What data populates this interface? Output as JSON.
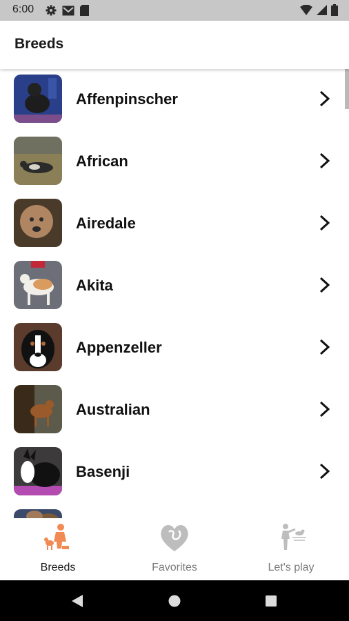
{
  "status_bar": {
    "time": "6:00",
    "icons_left": [
      "gear-icon",
      "gmail-icon",
      "sd-card-icon"
    ],
    "icons_right": [
      "wifi-icon",
      "cell-signal-icon",
      "battery-icon"
    ]
  },
  "app_bar": {
    "title": "Breeds"
  },
  "breeds": [
    {
      "name": "Affenpinscher",
      "thumb_colors": [
        "#2a3f8a",
        "#1d1d1d",
        "#7b4e8b"
      ]
    },
    {
      "name": "African",
      "thumb_colors": [
        "#8b7f57",
        "#2b2b2b",
        "#d6d2c8"
      ]
    },
    {
      "name": "Airedale",
      "thumb_colors": [
        "#4a3a2a",
        "#b08561",
        "#2a2a2a"
      ]
    },
    {
      "name": "Akita",
      "thumb_colors": [
        "#6c6f78",
        "#d99b5e",
        "#f2efe8"
      ]
    },
    {
      "name": "Appenzeller",
      "thumb_colors": [
        "#5a3b2c",
        "#111111",
        "#ffffff"
      ]
    },
    {
      "name": "Australian",
      "thumb_colors": [
        "#5c5a4a",
        "#9a5a2a",
        "#3a2a1a"
      ]
    },
    {
      "name": "Basenji",
      "thumb_colors": [
        "#3c3a3a",
        "#111111",
        "#b34bb0"
      ]
    },
    {
      "name": "",
      "thumb_colors": [
        "#3b4a6a",
        "#7a5a3a",
        "#a07a5a"
      ]
    }
  ],
  "bottom_nav": {
    "items": [
      {
        "label": "Breeds",
        "icon": "breeds-icon",
        "active": true
      },
      {
        "label": "Favorites",
        "icon": "favorites-icon",
        "active": false
      },
      {
        "label": "Let's play",
        "icon": "lets-play-icon",
        "active": false
      }
    ]
  },
  "colors": {
    "accent": "#f28a54",
    "inactive_icon": "#bdbdbd",
    "status_bar": "#c7c7c7",
    "system_nav": "#000000"
  },
  "system_nav": {
    "buttons": [
      "back-icon",
      "home-icon",
      "recents-icon"
    ]
  }
}
